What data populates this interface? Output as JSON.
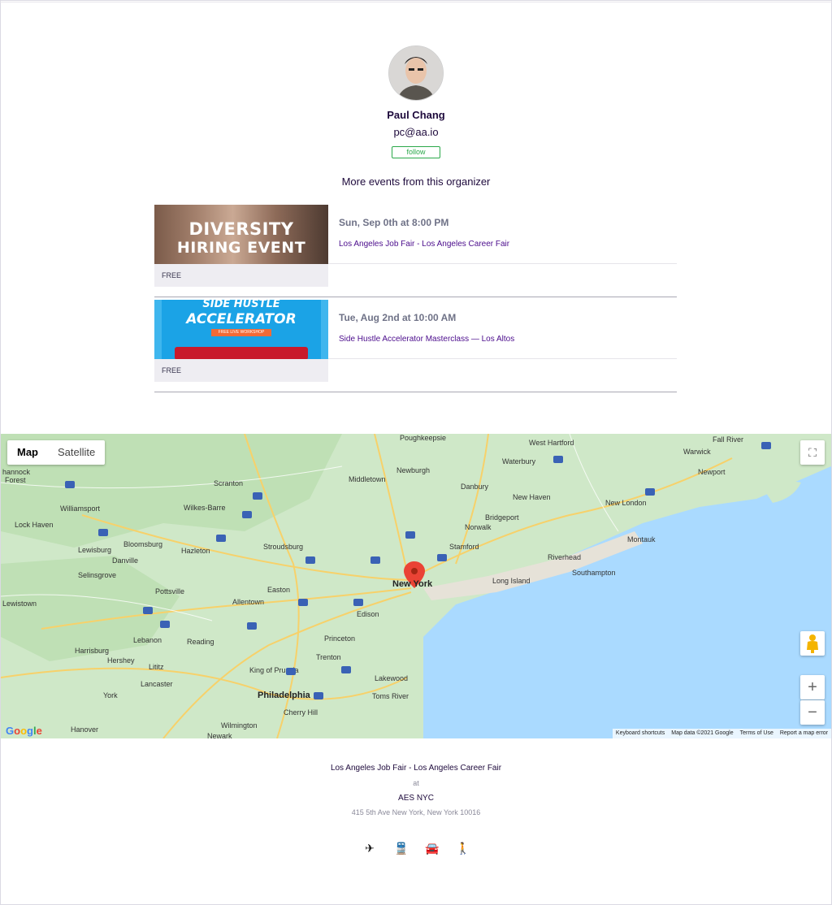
{
  "organizer": {
    "name": "Paul Chang",
    "email": "pc@aa.io",
    "follow_label": "follow"
  },
  "more_events": {
    "title": "More events from this organizer",
    "events": [
      {
        "image_text_line1": "DIVERSITY",
        "image_text_line2": "HIRING EVENT",
        "price": "FREE",
        "date": "Sun, Sep 0th at 8:00 PM",
        "title": "Los Angeles Job Fair - Los Angeles Career Fair"
      },
      {
        "image_text_line1": "SIDE HUSTLE",
        "image_text_line2": "ACCELERATOR",
        "image_badge": "FREE LIVE WORKSHOP",
        "price": "FREE",
        "date": "Tue, Aug 2nd at 10:00 AM",
        "title": "Side Hustle Accelerator Masterclass — Los Altos"
      }
    ]
  },
  "map": {
    "tab_map": "Map",
    "tab_satellite": "Satellite",
    "zoom_in": "+",
    "zoom_out": "−",
    "logo": "Google",
    "attribution": [
      "Keyboard shortcuts",
      "Map data ©2021 Google",
      "Terms of Use",
      "Report a map error"
    ],
    "labels": [
      "Poughkeepsie",
      "West Hartford",
      "Fall River",
      "Warwick",
      "Newburgh",
      "Waterbury",
      "Middletown",
      "Danbury",
      "Newport",
      "Scranton",
      "New Haven",
      "New London",
      "Williamsport",
      "Wilkes-Barre",
      "Bridgeport",
      "Norwalk",
      "Stamford",
      "Lock Haven",
      "Bloomsburg",
      "Montauk",
      "Hazleton",
      "Stroudsburg",
      "Riverhead",
      "Southampton",
      "Danville",
      "Lewisburg",
      "Selinsgrove",
      "Long Island",
      "Pottsville",
      "Easton",
      "Allentown",
      "Lewistown",
      "Edison",
      "Lebanon",
      "Reading",
      "Princeton",
      "Harrisburg",
      "Hershey",
      "Trenton",
      "Lakewood",
      "King of Prussia",
      "Lancaster",
      "Philadelphia",
      "Toms River",
      "York",
      "Cherry Hill",
      "Wilmington",
      "Hanover",
      "Newark",
      "Lititz"
    ],
    "city_label": "New York",
    "forest_label": "Forest",
    "hannock_label": "hannock"
  },
  "venue": {
    "event_title": "Los Angeles Job Fair - Los Angeles Career Fair",
    "at": "at",
    "name": "AES NYC",
    "address": "415 5th Ave New York, New York 10016"
  },
  "transport_icons": [
    "airplane-icon",
    "train-icon",
    "car-icon",
    "walk-icon"
  ],
  "colors": {
    "follow": "#2ba84a",
    "event_title": "#4b0c8c",
    "water": "#aadaff"
  }
}
